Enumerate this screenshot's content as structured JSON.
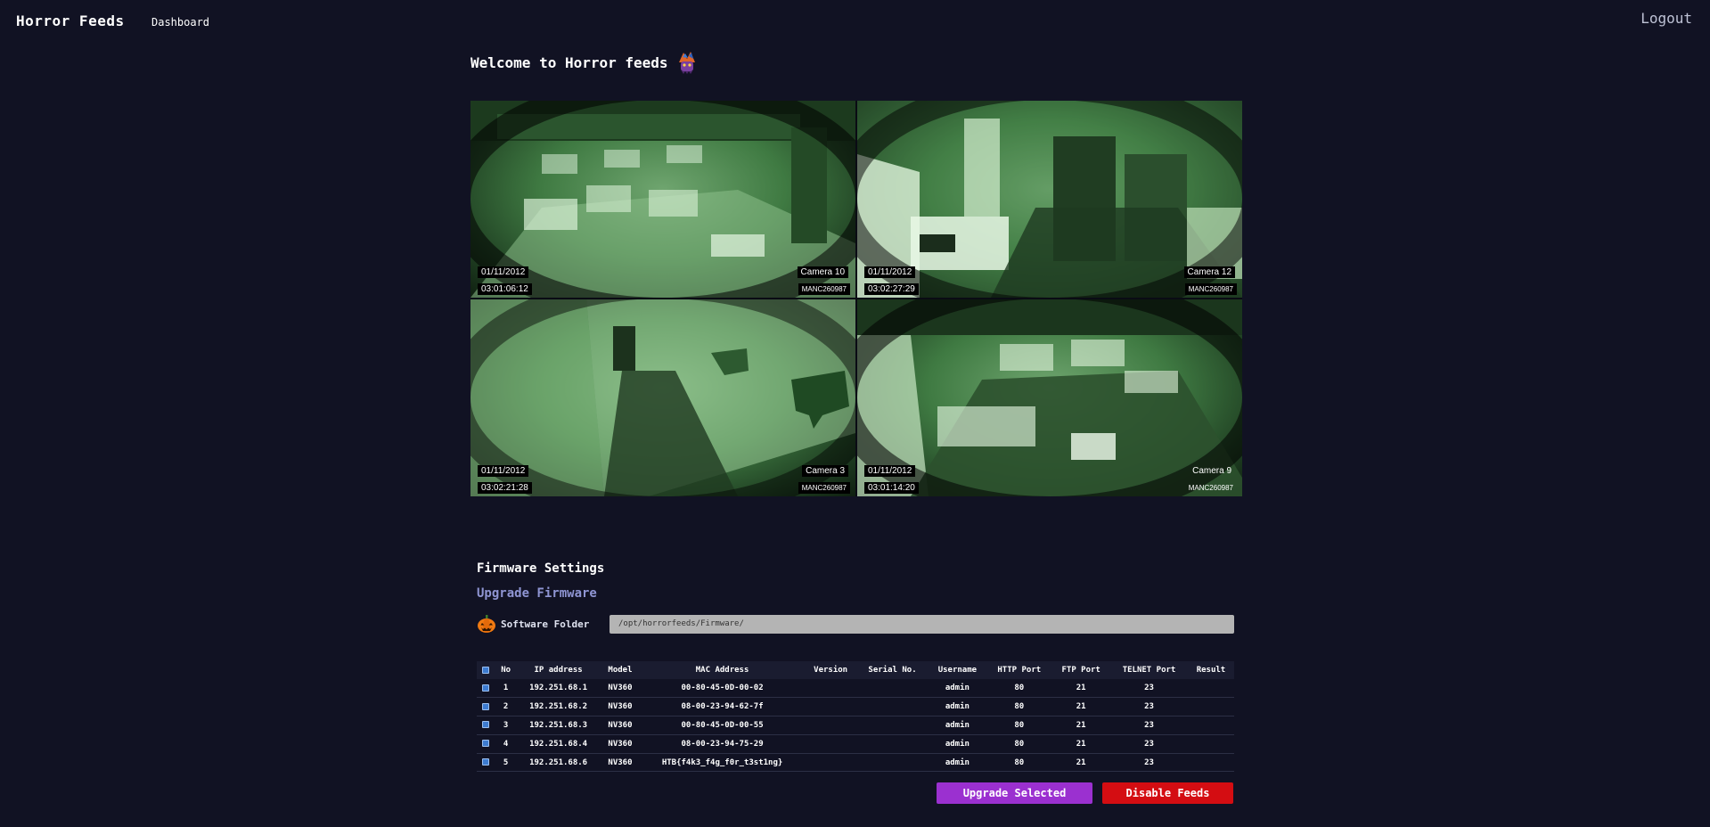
{
  "nav": {
    "brand": "Horror Feeds",
    "dashboard_link": "Dashboard",
    "logout_link": "Logout"
  },
  "welcome": {
    "title": "Welcome to Horror feeds"
  },
  "cameras": [
    {
      "date": "01/11/2012",
      "time": "03:01:06:12",
      "name": "Camera 10",
      "serial": "MANC260987"
    },
    {
      "date": "01/11/2012",
      "time": "03:02:27:29",
      "name": "Camera 12",
      "serial": "MANC260987"
    },
    {
      "date": "01/11/2012",
      "time": "03:02:21:28",
      "name": "Camera 3",
      "serial": "MANC260987"
    },
    {
      "date": "01/11/2012",
      "time": "03:01:14:20",
      "name": "Camera 9",
      "serial": "MANC260987"
    }
  ],
  "firmware": {
    "title": "Firmware Settings",
    "subtitle": "Upgrade Firmware",
    "folder_label": "Software Folder",
    "folder_value": "/opt/horrorfeeds/Firmware/"
  },
  "table": {
    "headers": {
      "no": "No",
      "ip": "IP address",
      "model": "Model",
      "mac": "MAC Address",
      "version": "Version",
      "serial": "Serial No.",
      "username": "Username",
      "http": "HTTP Port",
      "ftp": "FTP Port",
      "telnet": "TELNET Port",
      "result": "Result"
    },
    "rows": [
      {
        "no": "1",
        "ip": "192.251.68.1",
        "model": "NV360",
        "mac": "00-80-45-0D-00-02",
        "version": "",
        "serial": "",
        "username": "admin",
        "http": "80",
        "ftp": "21",
        "telnet": "23",
        "result": ""
      },
      {
        "no": "2",
        "ip": "192.251.68.2",
        "model": "NV360",
        "mac": "08-00-23-94-62-7f",
        "version": "",
        "serial": "",
        "username": "admin",
        "http": "80",
        "ftp": "21",
        "telnet": "23",
        "result": ""
      },
      {
        "no": "3",
        "ip": "192.251.68.3",
        "model": "NV360",
        "mac": "00-80-45-0D-00-55",
        "version": "",
        "serial": "",
        "username": "admin",
        "http": "80",
        "ftp": "21",
        "telnet": "23",
        "result": ""
      },
      {
        "no": "4",
        "ip": "192.251.68.4",
        "model": "NV360",
        "mac": "08-00-23-94-75-29",
        "version": "",
        "serial": "",
        "username": "admin",
        "http": "80",
        "ftp": "21",
        "telnet": "23",
        "result": ""
      },
      {
        "no": "5",
        "ip": "192.251.68.6",
        "model": "NV360",
        "mac": "HTB{f4k3_f4g_f0r_t3st1ng}",
        "version": "",
        "serial": "",
        "username": "admin",
        "http": "80",
        "ftp": "21",
        "telnet": "23",
        "result": ""
      }
    ]
  },
  "buttons": {
    "upgrade": "Upgrade Selected",
    "disable": "Disable Feeds"
  },
  "colors": {
    "background": "#111223",
    "accent_subtitle": "#8f95d3",
    "upgrade_button": "#9b30d0",
    "disable_button": "#d40d12",
    "night_vision_green": "#4f8a52"
  },
  "icons": {
    "welcome": "ghost-icon",
    "folder": "pumpkin-icon",
    "checkbox": "checkbox-checked-icon"
  }
}
